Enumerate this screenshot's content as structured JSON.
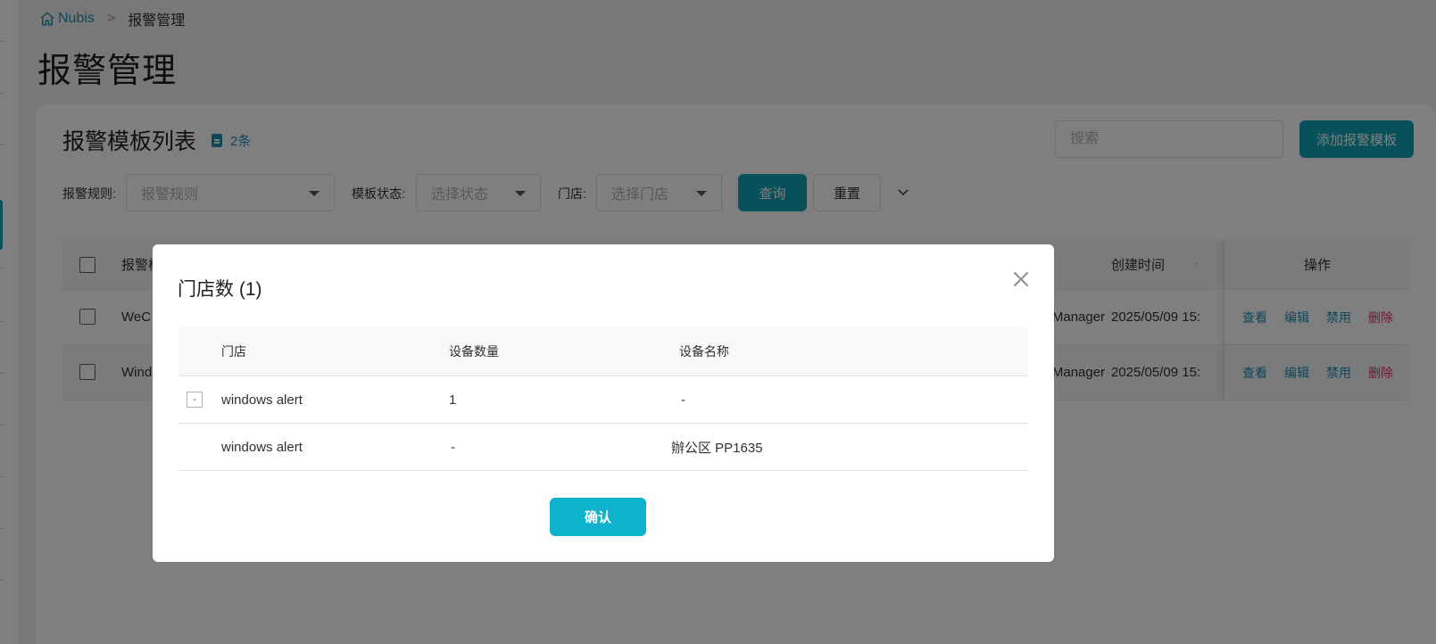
{
  "breadcrumb": {
    "home": "Nubis",
    "separator": ">",
    "current": "报警管理"
  },
  "page_title": "报警管理",
  "card": {
    "title": "报警模板列表",
    "count": "2条",
    "search_placeholder": "搜索",
    "add_button": "添加报警模板"
  },
  "filters": {
    "rule_label": "报警规则:",
    "rule_placeholder": "报警规则",
    "status_label": "模板状态:",
    "status_placeholder": "选择状态",
    "store_label": "门店:",
    "store_placeholder": "选择门店",
    "query_button": "查询",
    "reset_button": "重置"
  },
  "table": {
    "columns": {
      "name": "报警模",
      "created": "创建时间",
      "actions": "操作"
    },
    "rows": [
      {
        "name": "WeC",
        "creator": "untManager",
        "created": "2025/05/09 15:",
        "view": "查看",
        "edit": "编辑",
        "disable": "禁用",
        "delete": "删除"
      },
      {
        "name": "Wind",
        "creator": "untManager",
        "created": "2025/05/09 15:",
        "view": "查看",
        "edit": "编辑",
        "disable": "禁用",
        "delete": "删除"
      }
    ]
  },
  "dialog": {
    "title": "门店数 (1)",
    "columns": {
      "store": "门店",
      "device_count": "设备数量",
      "device_name": "设备名称"
    },
    "rows": [
      {
        "toggle": "-",
        "store": "windows alert",
        "device_count": "1",
        "device_name": "-"
      },
      {
        "store": "windows alert",
        "device_count": "-",
        "device_name": "辦公区 PP1635"
      }
    ],
    "confirm_button": "确认"
  }
}
